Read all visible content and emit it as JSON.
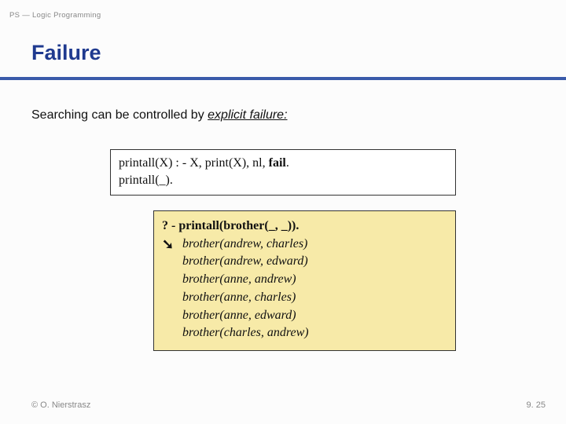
{
  "header": {
    "course": "PS — Logic Programming"
  },
  "title": "Failure",
  "intro": {
    "prefix": "Searching can be controlled by ",
    "emph": "explicit failure:"
  },
  "code1": {
    "line1_pre": "printall(X) : - X, print(X), nl, ",
    "line1_bold": "fail",
    "line1_post": ".",
    "line2": "printall(_)."
  },
  "code2": {
    "query": "? - printall(brother(_, _)).",
    "arrow": "➘",
    "results": [
      "brother(andrew, charles)",
      "brother(andrew, edward)",
      "brother(anne, andrew)",
      "brother(anne, charles)",
      "brother(anne, edward)",
      "brother(charles, andrew)"
    ]
  },
  "footer": {
    "left": "© O. Nierstrasz",
    "right": "9. 25"
  }
}
